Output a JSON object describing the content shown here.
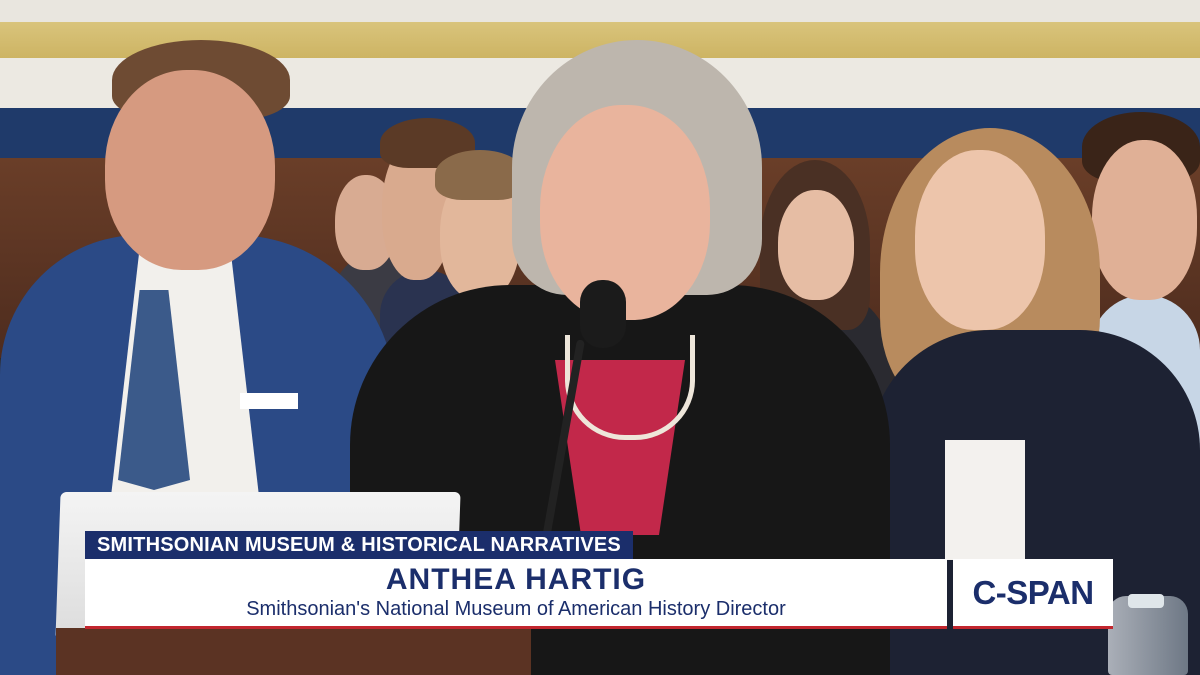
{
  "chyron": {
    "topic": "SMITHSONIAN MUSEUM & HISTORICAL NARRATIVES",
    "name": "ANTHEA HARTIG",
    "title": "Smithsonian's National Museum of American History Director"
  },
  "network_logo": "C-SPAN",
  "colors": {
    "chyron_navy": "#1b2e6b",
    "chyron_accent_red": "#c2262e",
    "wall_blue": "#1f3a6a",
    "wall_gold": "#cdb463"
  }
}
